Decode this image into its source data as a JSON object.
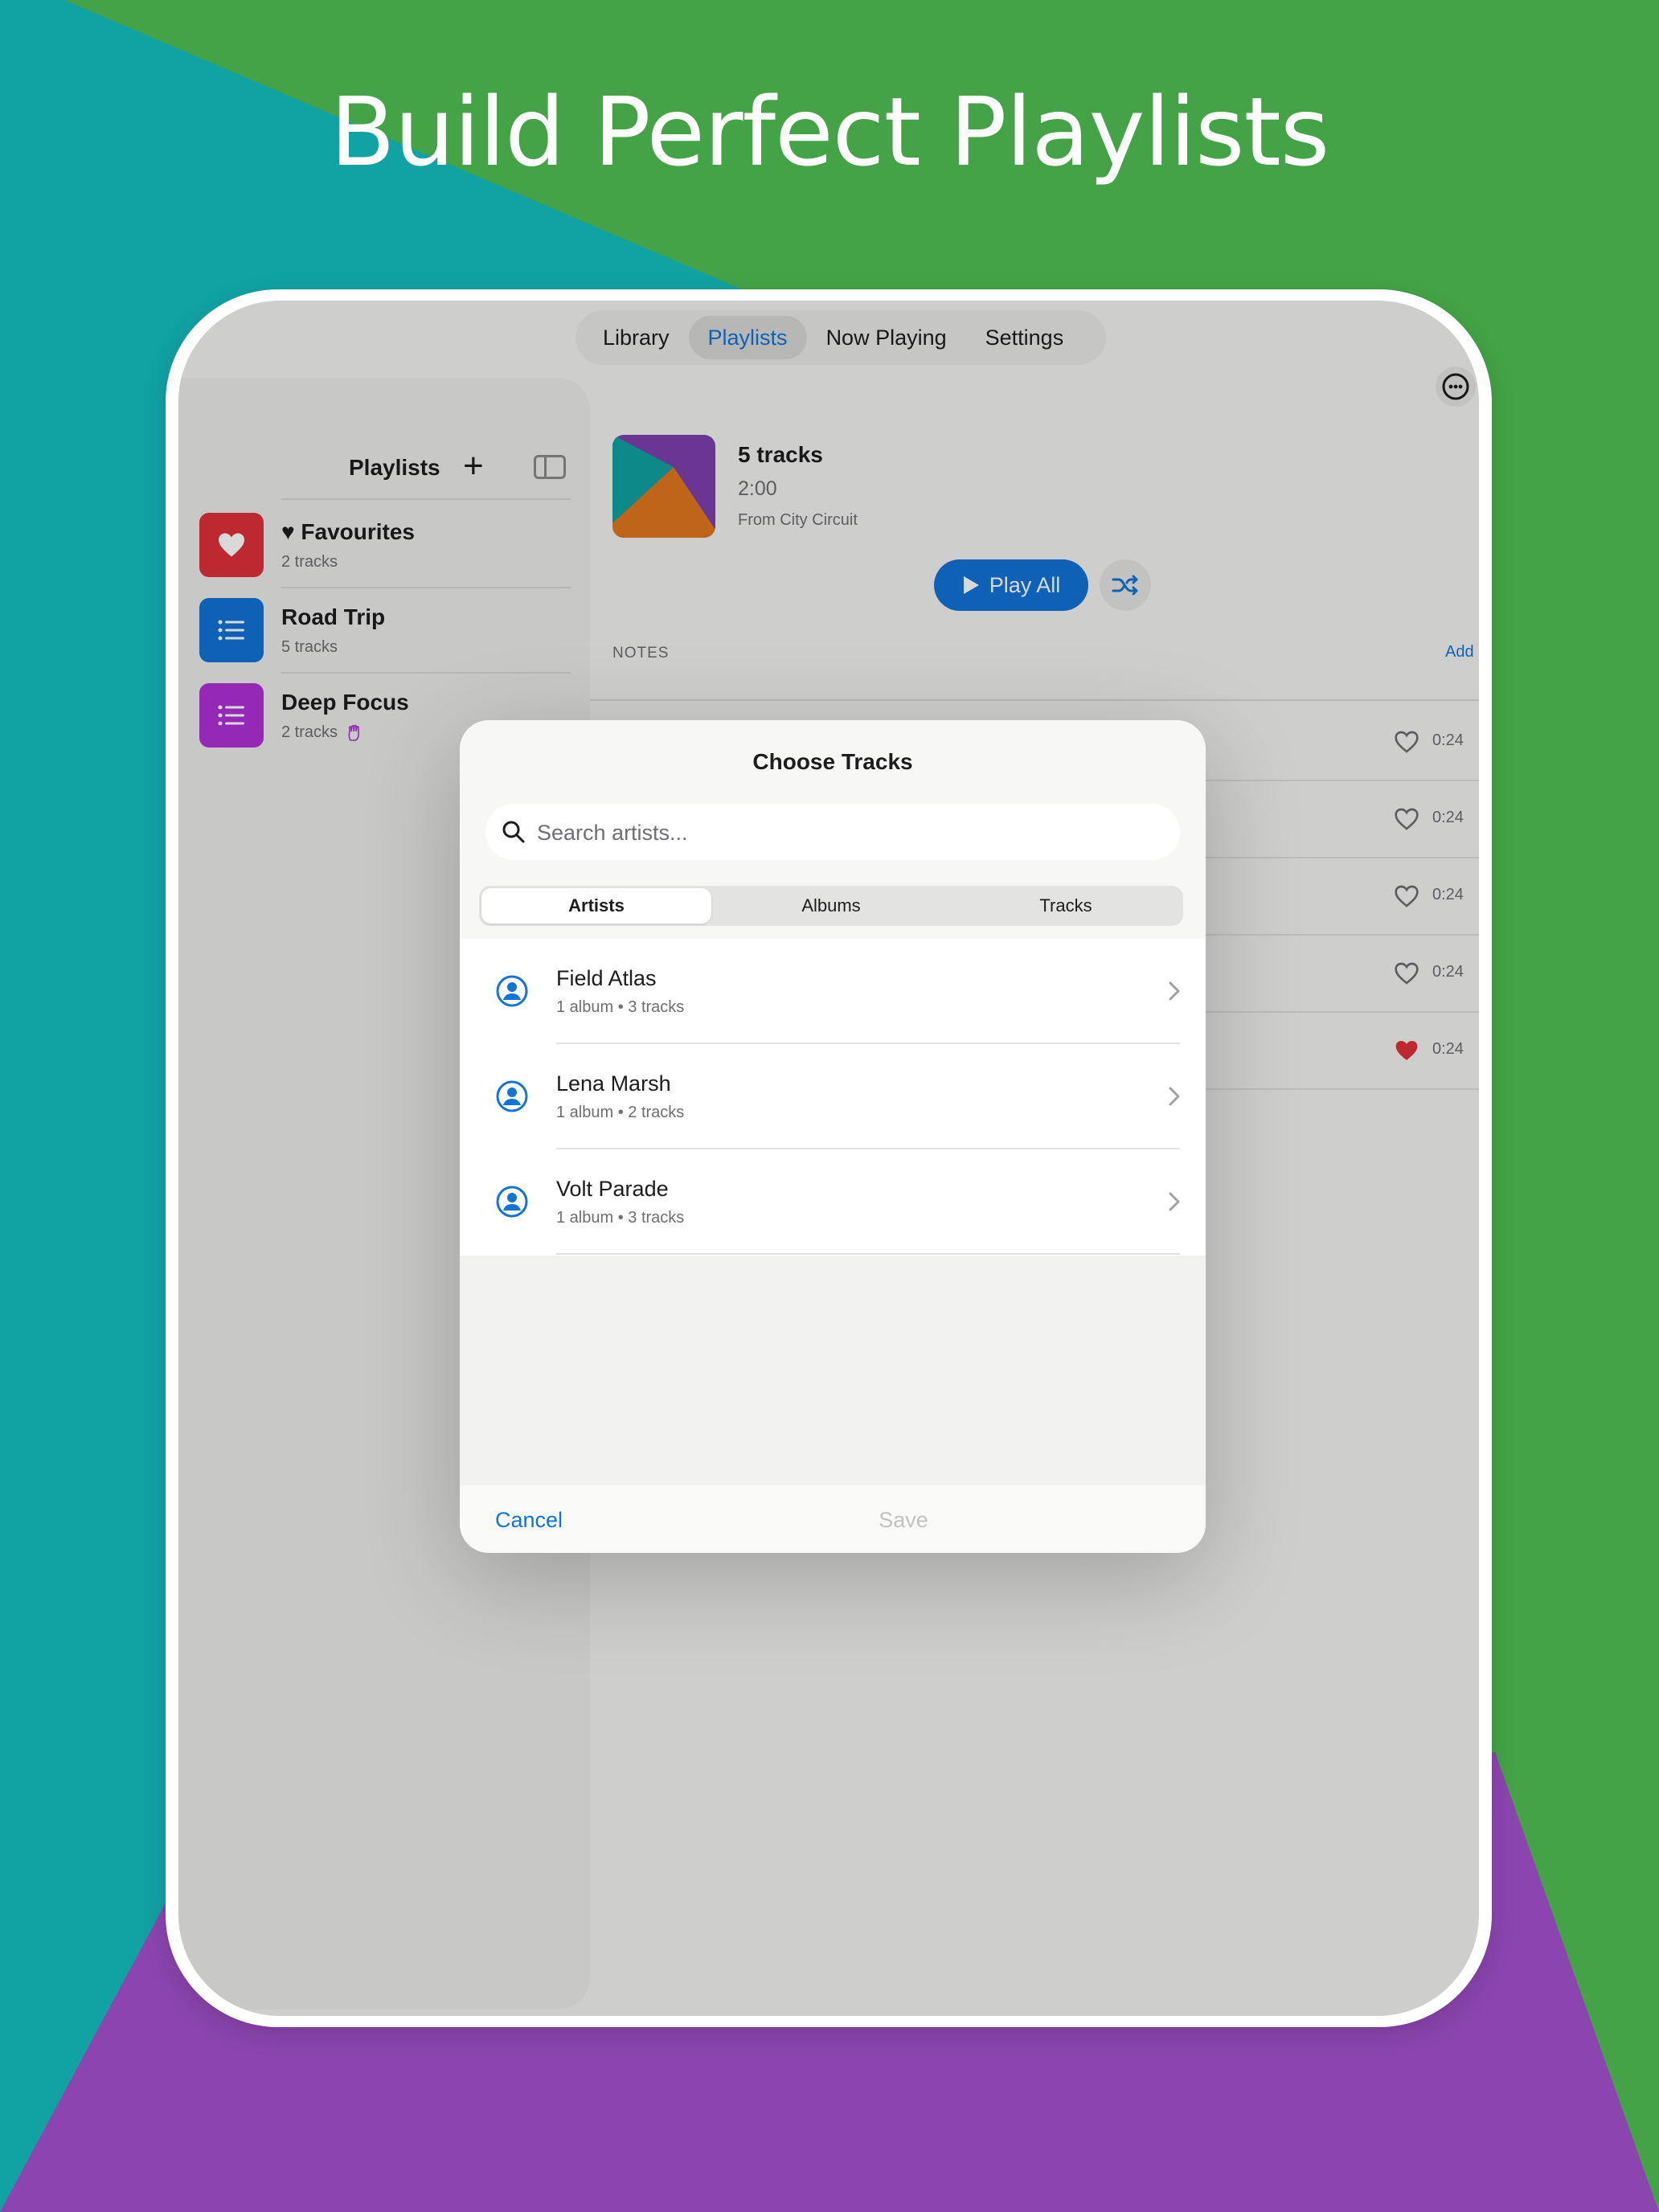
{
  "headline": "Build Perfect Playlists",
  "colors": {
    "background_green": "#44a346",
    "background_teal": "#11a2a3",
    "background_purple": "#8c45b0",
    "accent_blue": "#1273d9",
    "favourite_red": "#e0313a",
    "road_trip_blue": "#1273d9",
    "deep_focus_purple": "#b02fd6"
  },
  "tabs": [
    "Library",
    "Playlists",
    "Now Playing",
    "Settings"
  ],
  "active_tab": "Playlists",
  "sidebar": {
    "title": "Playlists",
    "playlists": [
      {
        "name": "♥ Favourites",
        "sub": "2 tracks",
        "icon": "heart-icon"
      },
      {
        "name": "Road Trip",
        "sub": "5 tracks",
        "icon": "list-icon"
      },
      {
        "name": "Deep Focus",
        "sub": "2 tracks",
        "icon": "list-icon"
      }
    ]
  },
  "detail": {
    "title": "5 tracks",
    "duration": "2:00",
    "from": "From City Circuit",
    "play_label": "Play All",
    "notes_label": "NOTES",
    "notes_add": "Add",
    "tracks": [
      {
        "time": "0:24",
        "favourite": false
      },
      {
        "time": "0:24",
        "favourite": false
      },
      {
        "time": "0:24",
        "favourite": false
      },
      {
        "time": "0:24",
        "favourite": false
      },
      {
        "time": "0:24",
        "favourite": true
      }
    ]
  },
  "modal": {
    "title": "Choose Tracks",
    "search_placeholder": "Search artists...",
    "segments": [
      "Artists",
      "Albums",
      "Tracks"
    ],
    "selected_segment": "Artists",
    "artists": [
      {
        "name": "Field Atlas",
        "meta": "1 album • 3 tracks"
      },
      {
        "name": "Lena Marsh",
        "meta": "1 album • 2 tracks"
      },
      {
        "name": "Volt Parade",
        "meta": "1 album • 3 tracks"
      }
    ],
    "cancel_label": "Cancel",
    "save_label": "Save"
  }
}
